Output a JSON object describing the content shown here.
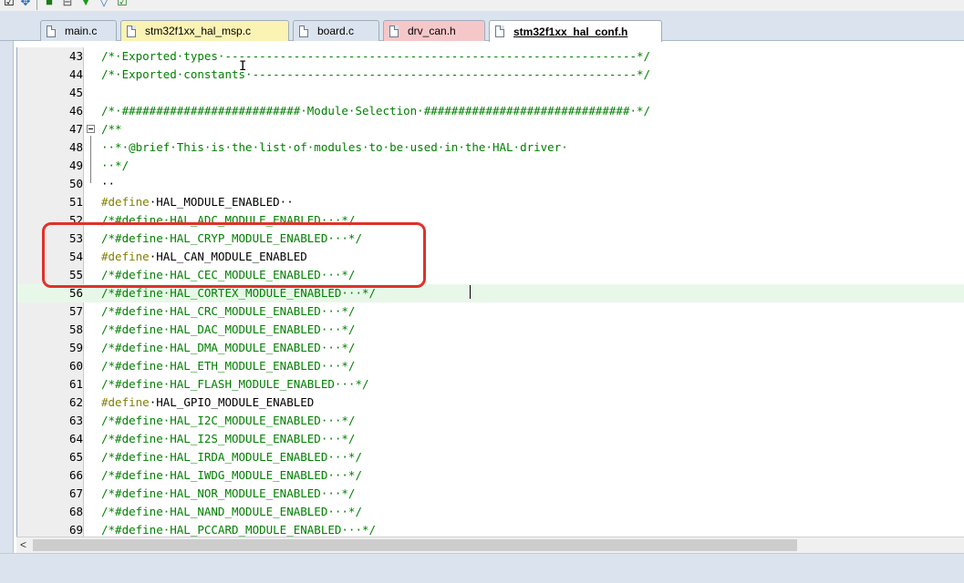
{
  "toolbar": {
    "icons": [
      "checkbox-icon",
      "cursor-icon",
      "bookmark-icon",
      "split-icon",
      "down-arrow-icon",
      "filter-icon",
      "check-icon"
    ]
  },
  "tabs": [
    {
      "label": "main.c",
      "color": "#dbe4ee",
      "active": false
    },
    {
      "label": "stm32f1xx_hal_msp.c",
      "color": "#fbf3b4",
      "active": false
    },
    {
      "label": "board.c",
      "color": "#dbe4ee",
      "active": false
    },
    {
      "label": "drv_can.h",
      "color": "#f6c7c9",
      "active": false
    },
    {
      "label": "stm32f1xx_hal_conf.h",
      "color": "#ffffff",
      "active": true
    }
  ],
  "lines": [
    {
      "num": "43",
      "text": "/*·Exported·types·------------------------------------------------------------*/",
      "kind": "comment"
    },
    {
      "num": "44",
      "text": "/*·Exported·constants·--------------------------------------------------------*/",
      "kind": "comment"
    },
    {
      "num": "45",
      "text": "",
      "kind": "plain"
    },
    {
      "num": "46",
      "text": "/*·##########################·Module·Selection·##############################·*/",
      "kind": "comment"
    },
    {
      "num": "47",
      "text": "/**",
      "kind": "comment"
    },
    {
      "num": "48",
      "text": "··*·@brief·This·is·the·list·of·modules·to·be·used·in·the·HAL·driver·",
      "kind": "comment"
    },
    {
      "num": "49",
      "text": "··*/",
      "kind": "comment"
    },
    {
      "num": "50",
      "text": "··",
      "kind": "plain"
    },
    {
      "num": "51",
      "kw": "#define",
      "id": "·HAL_MODULE_ENABLED··",
      "kind": "define"
    },
    {
      "num": "52",
      "text": "/*#define·HAL_ADC_MODULE_ENABLED···*/",
      "kind": "comment"
    },
    {
      "num": "53",
      "text": "/*#define·HAL_CRYP_MODULE_ENABLED···*/",
      "kind": "comment"
    },
    {
      "num": "54",
      "kw": "#define",
      "id": "·HAL_CAN_MODULE_ENABLED",
      "kind": "define"
    },
    {
      "num": "55",
      "text": "/*#define·HAL_CEC_MODULE_ENABLED···*/",
      "kind": "comment"
    },
    {
      "num": "56",
      "text": "/*#define·HAL_CORTEX_MODULE_ENABLED···*/",
      "kind": "comment"
    },
    {
      "num": "57",
      "text": "/*#define·HAL_CRC_MODULE_ENABLED···*/",
      "kind": "comment"
    },
    {
      "num": "58",
      "text": "/*#define·HAL_DAC_MODULE_ENABLED···*/",
      "kind": "comment"
    },
    {
      "num": "59",
      "text": "/*#define·HAL_DMA_MODULE_ENABLED···*/",
      "kind": "comment"
    },
    {
      "num": "60",
      "text": "/*#define·HAL_ETH_MODULE_ENABLED···*/",
      "kind": "comment"
    },
    {
      "num": "61",
      "text": "/*#define·HAL_FLASH_MODULE_ENABLED···*/",
      "kind": "comment"
    },
    {
      "num": "62",
      "kw": "#define",
      "id": "·HAL_GPIO_MODULE_ENABLED",
      "kind": "define"
    },
    {
      "num": "63",
      "text": "/*#define·HAL_I2C_MODULE_ENABLED···*/",
      "kind": "comment"
    },
    {
      "num": "64",
      "text": "/*#define·HAL_I2S_MODULE_ENABLED···*/",
      "kind": "comment"
    },
    {
      "num": "65",
      "text": "/*#define·HAL_IRDA_MODULE_ENABLED···*/",
      "kind": "comment"
    },
    {
      "num": "66",
      "text": "/*#define·HAL_IWDG_MODULE_ENABLED···*/",
      "kind": "comment"
    },
    {
      "num": "67",
      "text": "/*#define·HAL_NOR_MODULE_ENABLED···*/",
      "kind": "comment"
    },
    {
      "num": "68",
      "text": "/*#define·HAL_NAND_MODULE_ENABLED···*/",
      "kind": "comment"
    },
    {
      "num": "69",
      "text": "/*#define·HAL_PCCARD_MODULE_ENABLED···*/",
      "kind": "comment"
    }
  ],
  "current_line": "56",
  "highlighted_lines": [
    "53",
    "54",
    "55"
  ],
  "scrollbar": {
    "left_arrow": "<"
  }
}
